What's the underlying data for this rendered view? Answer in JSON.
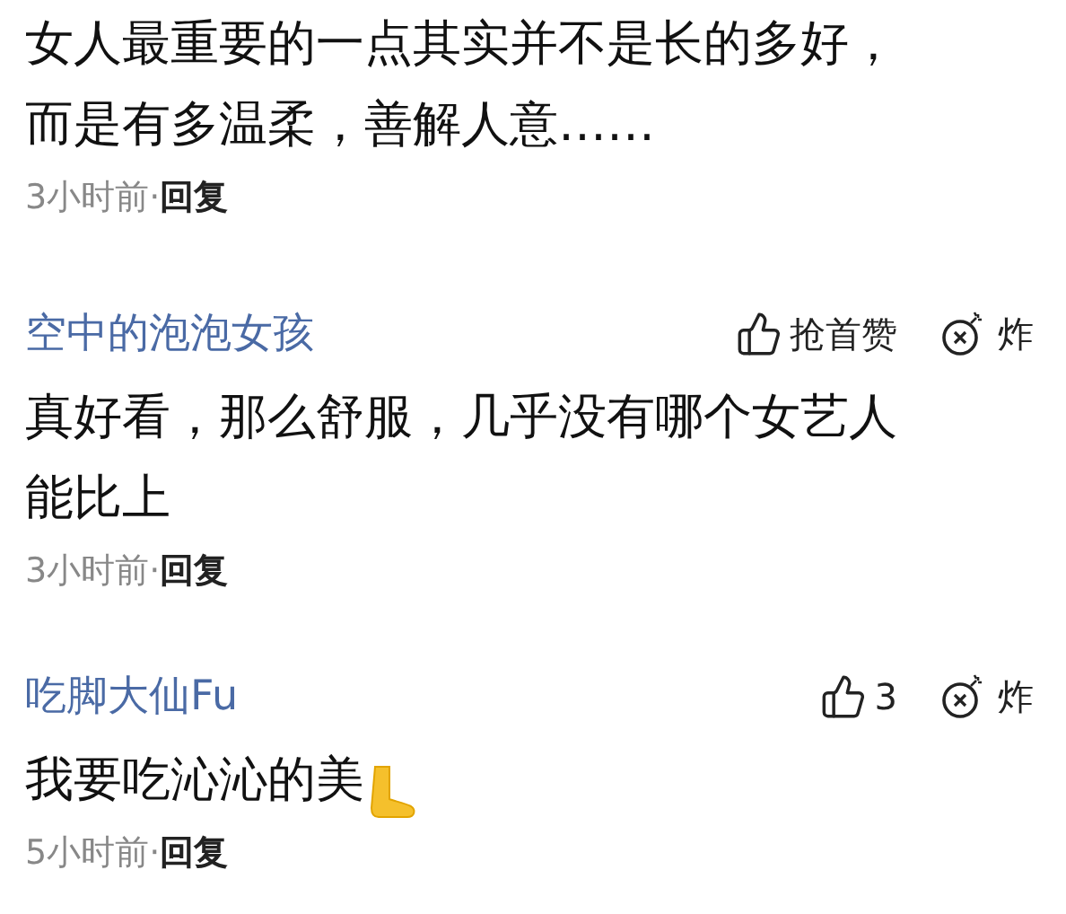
{
  "comments": [
    {
      "kind": "text",
      "text": "女人最重要的一点其实并不是长的多好，而是有多温柔，善解人意……",
      "time": "3小时前·",
      "reply": "回复"
    },
    {
      "kind": "text",
      "user": "空中的泡泡女孩",
      "likes": "抢首赞",
      "bomb": "炸",
      "text": "真好看，那么舒服，几乎没有哪个女艺人能比上",
      "time": "3小时前·",
      "reply": "回复"
    },
    {
      "kind": "text_with_foot",
      "user": "吃脚大仙Fu",
      "likes": "3",
      "bomb": "炸",
      "text": "我要吃沁沁的美",
      "time": "5小时前·",
      "reply": "回复"
    }
  ]
}
